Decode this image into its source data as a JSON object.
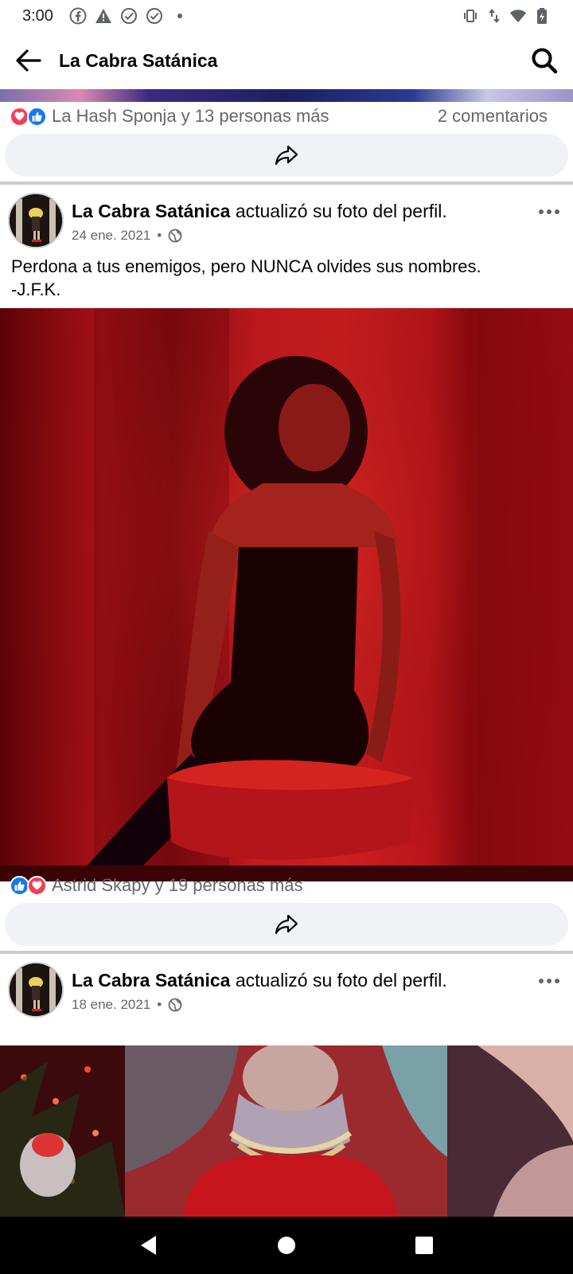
{
  "status_bar": {
    "time": "3:00",
    "left_icons": [
      "facebook-icon",
      "warning-icon",
      "check-circle-icon",
      "check-circle-icon",
      "dot-icon"
    ],
    "right_icons": [
      "vibrate-icon",
      "data-arrows-icon",
      "wifi-icon",
      "battery-icon"
    ]
  },
  "app_bar": {
    "title": "La Cabra Satánica",
    "back_icon": "back-arrow-icon",
    "search_icon": "search-icon"
  },
  "posts": [
    {
      "reactions": [
        "love",
        "like"
      ],
      "reactions_text": "La Hash Sponja y 13 personas más",
      "comments_text": "2 comentarios"
    },
    {
      "author": "La Cabra Satánica",
      "action": "actualizó su foto del perfil.",
      "date": "24 ene. 2021",
      "dot": "•",
      "privacy_icon": "globe-icon",
      "text_line1": "Perdona a tus enemigos, pero NUNCA olvides sus nombres.",
      "text_line2": "-J.F.K.",
      "reactions": [
        "like",
        "love"
      ],
      "reactions_text": "Astrid Skapy y 19 personas más"
    },
    {
      "author": "La Cabra Satánica",
      "action": "actualizó su foto del perfil.",
      "date": "18 ene. 2021",
      "dot": "•",
      "privacy_icon": "globe-icon"
    }
  ],
  "nav_bar": {
    "icons": [
      "back-triangle-icon",
      "home-circle-icon",
      "recents-square-icon"
    ]
  },
  "colors": {
    "facebook_blue": "#1877f2",
    "love_red": "#f33e58",
    "secondary_text": "#65676b",
    "share_bg": "#f0f2f5",
    "separator": "#c9ccd1"
  }
}
